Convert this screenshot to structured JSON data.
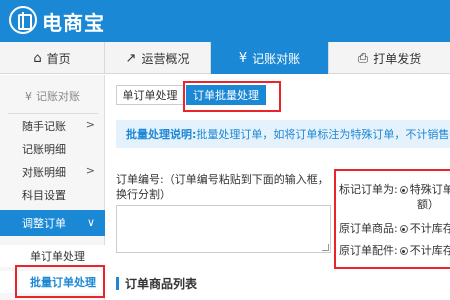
{
  "app": {
    "logo_text": "电商宝"
  },
  "tabs": [
    {
      "icon": "home-icon",
      "glyph": "⌂",
      "label": "首页"
    },
    {
      "icon": "chart-icon",
      "glyph": "↗",
      "label": "运营概况"
    },
    {
      "icon": "yen-icon",
      "glyph": "¥",
      "label": "记账对账"
    },
    {
      "icon": "printer-icon",
      "glyph": "⎙",
      "label": "打单发货"
    }
  ],
  "sidebar": {
    "title": "记账对账",
    "title_icon": "¥",
    "items": [
      {
        "label": "随手记账",
        "chevron": ">"
      },
      {
        "label": "记账明细",
        "chevron": ""
      },
      {
        "label": "对账明细",
        "chevron": ">"
      },
      {
        "label": "科目设置",
        "chevron": ""
      },
      {
        "label": "调整订单",
        "chevron": "∨"
      }
    ],
    "subitems": [
      {
        "label": "单订单处理"
      },
      {
        "label": "批量订单处理"
      }
    ]
  },
  "content": {
    "sub_tabs": [
      {
        "label": "单订单处理"
      },
      {
        "label": "订单批量处理"
      }
    ],
    "info_bold": "批量处理说明:",
    "info_text": "批量处理订单，如将订单标注为特殊订单，不计销售数",
    "field_label": "订单编号:（订单编号粘贴到下面的输入框，换行分割）",
    "options": [
      {
        "label": "标记订单为:",
        "value": "特殊订单"
      },
      {
        "label": "",
        "value": "额）"
      },
      {
        "label": "原订单商品:",
        "value": "不计库存"
      },
      {
        "label": "原订单配件:",
        "value": "不计库存"
      }
    ],
    "section_title": "订单商品列表"
  },
  "colors": {
    "brand": "#1b88d6",
    "highlight": "#e8252b"
  }
}
